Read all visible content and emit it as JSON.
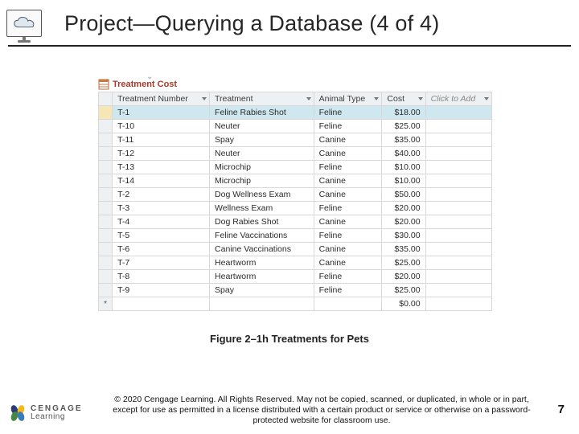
{
  "title": "Project—Querying a Database (4 of 4)",
  "tab": {
    "label": "Treatment Cost"
  },
  "columns": {
    "c0": "Treatment Number",
    "c1": "Treatment",
    "c2": "Animal Type",
    "c3": "Cost",
    "c4": "Click to Add"
  },
  "rows": [
    {
      "num": "T-1",
      "treatment": "Feline Rabies Shot",
      "animal": "Feline",
      "cost": "$18.00"
    },
    {
      "num": "T-10",
      "treatment": "Neuter",
      "animal": "Feline",
      "cost": "$25.00"
    },
    {
      "num": "T-11",
      "treatment": "Spay",
      "animal": "Canine",
      "cost": "$35.00"
    },
    {
      "num": "T-12",
      "treatment": "Neuter",
      "animal": "Canine",
      "cost": "$40.00"
    },
    {
      "num": "T-13",
      "treatment": "Microchip",
      "animal": "Feline",
      "cost": "$10.00"
    },
    {
      "num": "T-14",
      "treatment": "Microchip",
      "animal": "Canine",
      "cost": "$10.00"
    },
    {
      "num": "T-2",
      "treatment": "Dog Wellness Exam",
      "animal": "Canine",
      "cost": "$50.00"
    },
    {
      "num": "T-3",
      "treatment": "Wellness Exam",
      "animal": "Feline",
      "cost": "$20.00"
    },
    {
      "num": "T-4",
      "treatment": "Dog Rabies Shot",
      "animal": "Canine",
      "cost": "$20.00"
    },
    {
      "num": "T-5",
      "treatment": "Feline Vaccinations",
      "animal": "Feline",
      "cost": "$30.00"
    },
    {
      "num": "T-6",
      "treatment": "Canine Vaccinations",
      "animal": "Canine",
      "cost": "$35.00"
    },
    {
      "num": "T-7",
      "treatment": "Heartworm",
      "animal": "Canine",
      "cost": "$25.00"
    },
    {
      "num": "T-8",
      "treatment": "Heartworm",
      "animal": "Feline",
      "cost": "$20.00"
    },
    {
      "num": "T-9",
      "treatment": "Spay",
      "animal": "Feline",
      "cost": "$25.00"
    }
  ],
  "new_row_cost": "$0.00",
  "new_row_marker": "*",
  "caption": "Figure 2–1h Treatments for Pets",
  "logo": {
    "line1": "CENGAGE",
    "line2": "Learning"
  },
  "copyright": "© 2020 Cengage Learning. All Rights Reserved. May not be copied, scanned, or duplicated, in whole or in part, except for use as permitted in a license distributed with a certain product or service or otherwise on a password-protected website for classroom use.",
  "page_number": "7"
}
